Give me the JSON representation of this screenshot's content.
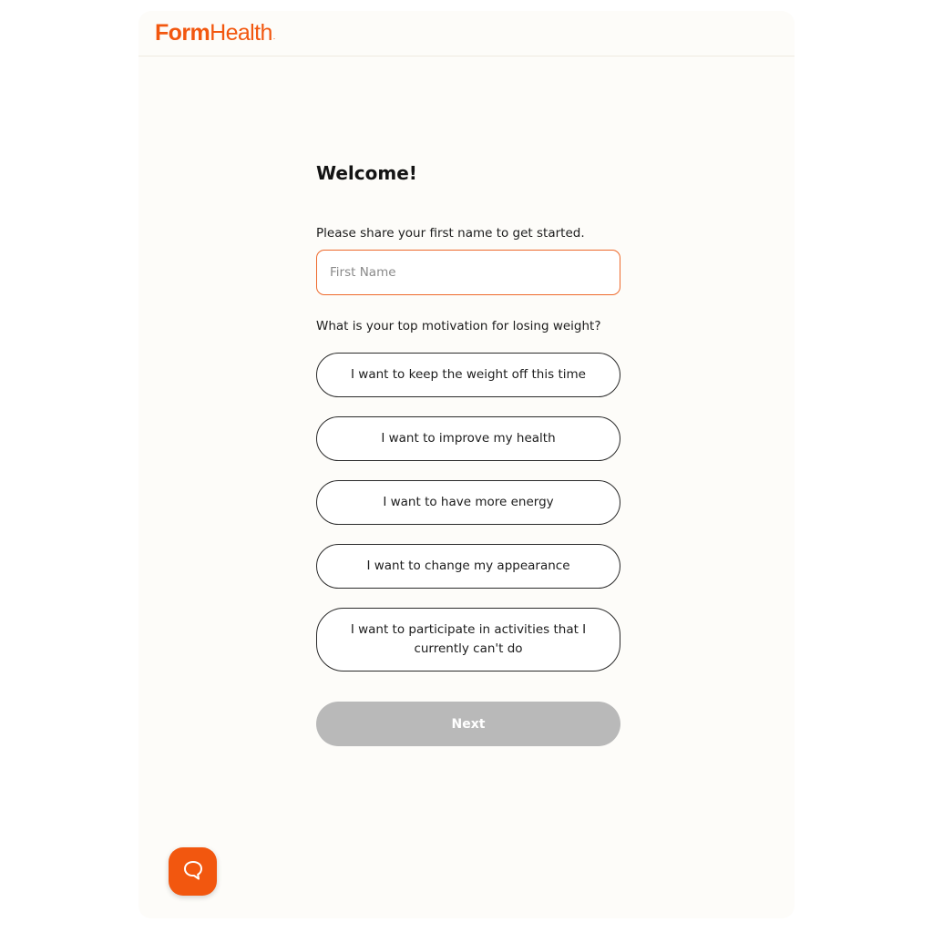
{
  "brand": {
    "logo_form": "Form",
    "logo_health": "Health",
    "logo_mark": ".",
    "color": "#f2570f"
  },
  "form": {
    "title": "Welcome!",
    "name_prompt": "Please share your first name to get started.",
    "name_placeholder": "First Name",
    "name_value": "",
    "motivation_prompt": "What is your top motivation for losing weight?",
    "options": [
      {
        "label": "I want to keep the weight off this time"
      },
      {
        "label": "I want to improve my health"
      },
      {
        "label": "I want to have more energy"
      },
      {
        "label": "I want to change my appearance"
      },
      {
        "label": "I want to participate in activities that I currently can't do"
      }
    ],
    "next_label": "Next",
    "next_enabled": false
  },
  "chat": {
    "icon": "chat-bubble-icon"
  }
}
